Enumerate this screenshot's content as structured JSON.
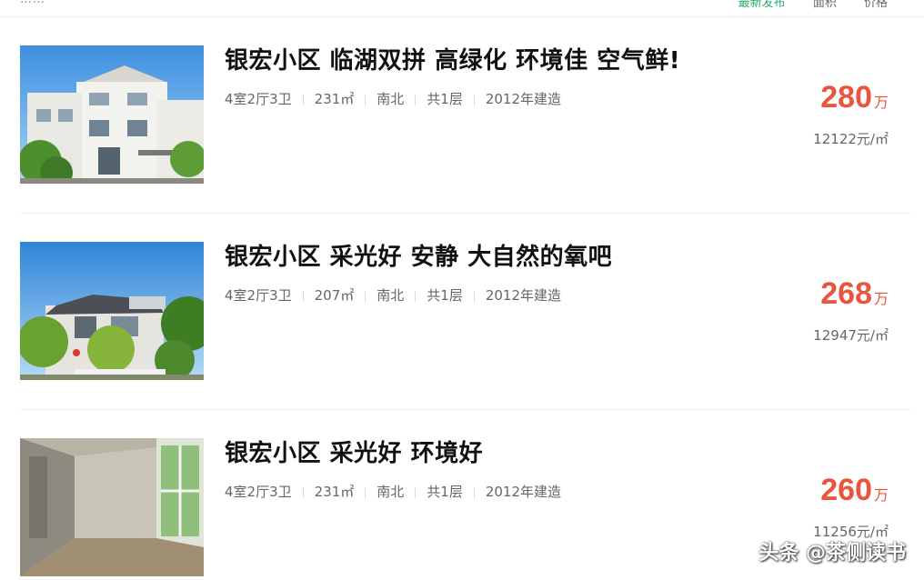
{
  "topbar": {
    "left_text": "……",
    "sort_new": "最新发布",
    "sort_area": "面积",
    "sort_price": "价格"
  },
  "listings": [
    {
      "title": "银宏小区 临湖双拼 高绿化 环境佳 空气鲜!",
      "layout": "4室2厅3卫",
      "area": "231㎡",
      "orientation": "南北",
      "floors": "共1层",
      "built": "2012年建造",
      "price": "280",
      "price_unit": "万",
      "unit_price": "12122元/㎡"
    },
    {
      "title": "银宏小区 采光好 安静 大自然的氧吧",
      "layout": "4室2厅3卫",
      "area": "207㎡",
      "orientation": "南北",
      "floors": "共1层",
      "built": "2012年建造",
      "price": "268",
      "price_unit": "万",
      "unit_price": "12947元/㎡"
    },
    {
      "title": "银宏小区 采光好 环境好",
      "layout": "4室2厅3卫",
      "area": "231㎡",
      "orientation": "南北",
      "floors": "共1层",
      "built": "2012年建造",
      "price": "260",
      "price_unit": "万",
      "unit_price": "11256元/㎡"
    }
  ],
  "watermark": "头条 @茶侧读书"
}
